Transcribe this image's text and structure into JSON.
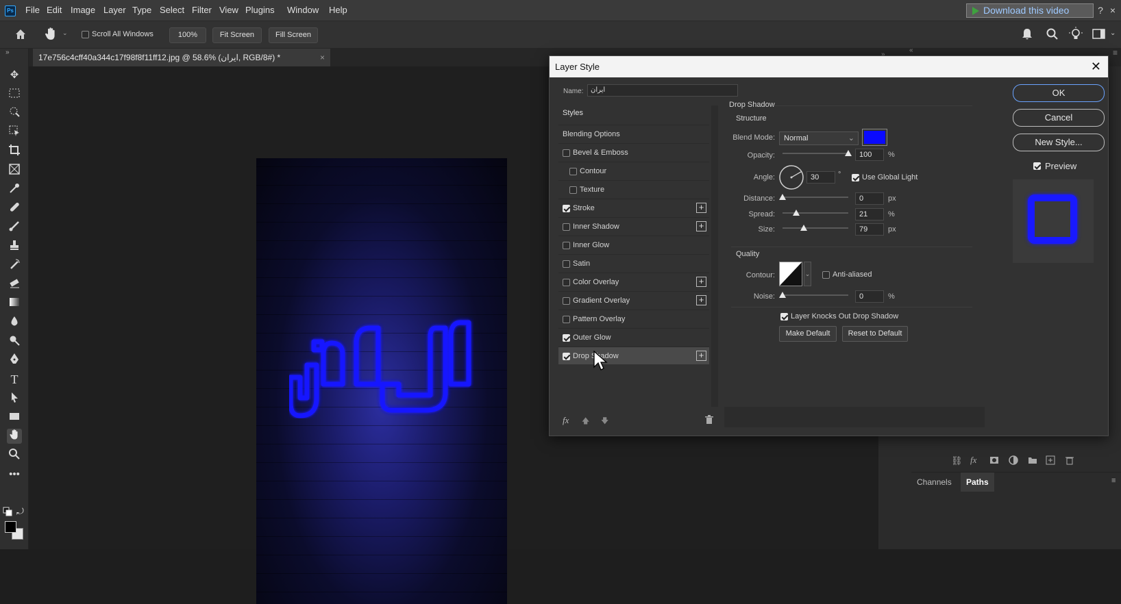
{
  "app": {
    "logo": "Ps"
  },
  "menu": [
    "File",
    "Edit",
    "Image",
    "Layer",
    "Type",
    "Select",
    "Filter",
    "View",
    "Plugins",
    "Window",
    "Help"
  ],
  "overlay": {
    "download_label": "Download this video",
    "help": "?",
    "close": "×"
  },
  "options_bar": {
    "scroll_all_label": "Scroll All Windows",
    "zoom_label": "100%",
    "fit_screen_label": "Fit Screen",
    "fill_screen_label": "Fill Screen"
  },
  "document_tab": {
    "title": "17e756c4cff40a344c17f98f8f11ff12.jpg @ 58.6% (ایران, RGB/8#) *"
  },
  "panels": {
    "tabs": [
      "Channels",
      "Paths"
    ],
    "active": "Paths"
  },
  "dialog": {
    "title": "Layer Style",
    "name_label": "Name:",
    "name_value": "ایران",
    "styles_header": "Styles",
    "items": [
      {
        "label": "Blending Options",
        "has_check": false,
        "checked": false,
        "has_plus": false,
        "indent": false
      },
      {
        "label": "Bevel & Emboss",
        "has_check": true,
        "checked": false,
        "has_plus": false,
        "indent": false
      },
      {
        "label": "Contour",
        "has_check": true,
        "checked": false,
        "has_plus": false,
        "indent": true
      },
      {
        "label": "Texture",
        "has_check": true,
        "checked": false,
        "has_plus": false,
        "indent": true
      },
      {
        "label": "Stroke",
        "has_check": true,
        "checked": true,
        "has_plus": true,
        "indent": false
      },
      {
        "label": "Inner Shadow",
        "has_check": true,
        "checked": false,
        "has_plus": true,
        "indent": false
      },
      {
        "label": "Inner Glow",
        "has_check": true,
        "checked": false,
        "has_plus": false,
        "indent": false
      },
      {
        "label": "Satin",
        "has_check": true,
        "checked": false,
        "has_plus": false,
        "indent": false
      },
      {
        "label": "Color Overlay",
        "has_check": true,
        "checked": false,
        "has_plus": true,
        "indent": false
      },
      {
        "label": "Gradient Overlay",
        "has_check": true,
        "checked": false,
        "has_plus": true,
        "indent": false
      },
      {
        "label": "Pattern Overlay",
        "has_check": true,
        "checked": false,
        "has_plus": false,
        "indent": false
      },
      {
        "label": "Outer Glow",
        "has_check": true,
        "checked": true,
        "has_plus": false,
        "indent": false
      },
      {
        "label": "Drop Shadow",
        "has_check": true,
        "checked": true,
        "has_plus": true,
        "indent": false,
        "active": true
      }
    ],
    "fx_label": "fx",
    "section_title": "Drop Shadow",
    "structure_title": "Structure",
    "blend_mode_label": "Blend Mode:",
    "blend_mode_value": "Normal",
    "shadow_color": "#0a0aff",
    "opacity_label": "Opacity:",
    "opacity_value": "100",
    "opacity_unit": "%",
    "opacity_fraction": 1.0,
    "angle_label": "Angle:",
    "angle_value": "30",
    "angle_unit": "°",
    "use_global_light_label": "Use Global Light",
    "use_global_light": true,
    "distance_label": "Distance:",
    "distance_value": "0",
    "distance_unit": "px",
    "distance_fraction": 0.0,
    "spread_label": "Spread:",
    "spread_value": "21",
    "spread_unit": "%",
    "spread_fraction": 0.21,
    "size_label": "Size:",
    "size_value": "79",
    "size_unit": "px",
    "size_fraction": 0.32,
    "quality_title": "Quality",
    "contour_label": "Contour:",
    "anti_aliased_label": "Anti-aliased",
    "anti_aliased": false,
    "noise_label": "Noise:",
    "noise_value": "0",
    "noise_unit": "%",
    "noise_fraction": 0.0,
    "knockout_label": "Layer Knocks Out Drop Shadow",
    "knockout": true,
    "make_default_label": "Make Default",
    "reset_default_label": "Reset to Default",
    "ok_label": "OK",
    "cancel_label": "Cancel",
    "new_style_label": "New Style...",
    "preview_label": "Preview",
    "preview_checked": true
  },
  "artwork": {
    "text": "ایران",
    "glow_color": "#1a1aff"
  }
}
